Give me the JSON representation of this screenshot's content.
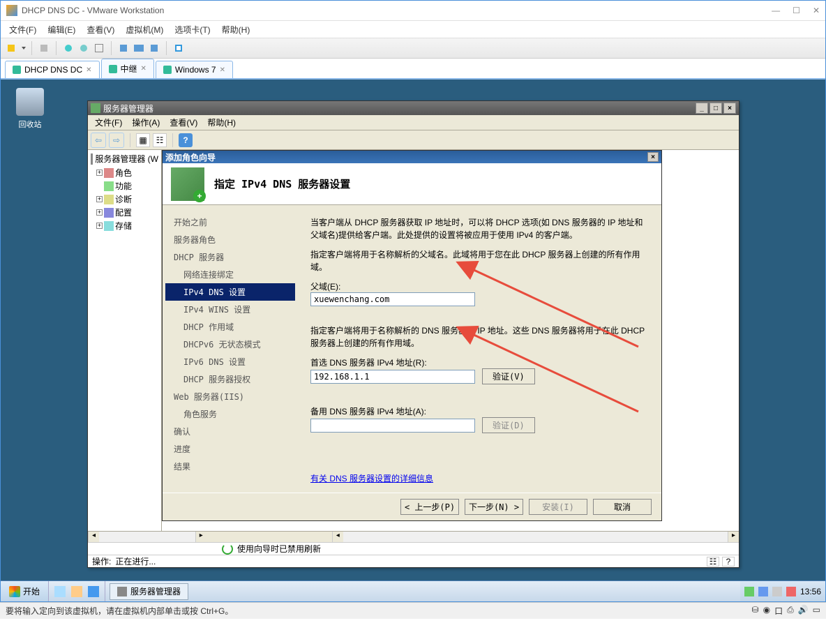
{
  "vmware": {
    "title": "DHCP DNS DC - VMware Workstation",
    "menu": [
      "文件(F)",
      "编辑(E)",
      "查看(V)",
      "虚拟机(M)",
      "选项卡(T)",
      "帮助(H)"
    ],
    "tabs": [
      {
        "label": "DHCP DNS DC",
        "active": true
      },
      {
        "label": "中继",
        "active": false
      },
      {
        "label": "Windows 7",
        "active": false
      }
    ],
    "status": "要将输入定向到该虚拟机，请在虚拟机内部单击或按 Ctrl+G。"
  },
  "desktop": {
    "recycle_bin": "回收站"
  },
  "srvmgr": {
    "title": "服务器管理器",
    "menu": [
      "文件(F)",
      "操作(A)",
      "查看(V)",
      "帮助(H)"
    ],
    "tree_root": "服务器管理器 (W",
    "tree_items": [
      "角色",
      "功能",
      "诊断",
      "配置",
      "存储"
    ],
    "refresh_msg": "使用向导时已禁用刷新",
    "op_label": "操作:",
    "op_status": "正在进行..."
  },
  "wizard": {
    "title": "添加角色向导",
    "heading": "指定 IPv4 DNS 服务器设置",
    "nav": [
      {
        "label": "开始之前",
        "level": 1
      },
      {
        "label": "服务器角色",
        "level": 1
      },
      {
        "label": "DHCP 服务器",
        "level": 1
      },
      {
        "label": "网络连接绑定",
        "level": 2
      },
      {
        "label": "IPv4 DNS 设置",
        "level": 2,
        "active": true
      },
      {
        "label": "IPv4 WINS 设置",
        "level": 2
      },
      {
        "label": "DHCP 作用域",
        "level": 2
      },
      {
        "label": "DHCPv6 无状态模式",
        "level": 2
      },
      {
        "label": "IPv6 DNS 设置",
        "level": 2
      },
      {
        "label": "DHCP 服务器授权",
        "level": 2
      },
      {
        "label": "Web 服务器(IIS)",
        "level": 1
      },
      {
        "label": "角色服务",
        "level": 2
      },
      {
        "label": "确认",
        "level": 1
      },
      {
        "label": "进度",
        "level": 1
      },
      {
        "label": "结果",
        "level": 1
      }
    ],
    "intro1": "当客户端从 DHCP 服务器获取 IP 地址时，可以将 DHCP 选项(如 DNS 服务器的 IP 地址和父域名)提供给客户端。此处提供的设置将被应用于使用 IPv4 的客户端。",
    "intro2": "指定客户端将用于名称解析的父域名。此域将用于您在此 DHCP 服务器上创建的所有作用域。",
    "parent_domain_label": "父域(E):",
    "parent_domain_value": "xuewenchang.com",
    "dns_intro": "指定客户端将用于名称解析的 DNS 服务器的 IP 地址。这些 DNS 服务器将用于在此 DHCP 服务器上创建的所有作用域。",
    "pref_dns_label": "首选 DNS 服务器 IPv4 地址(R):",
    "pref_dns_value": "192.168.1.1",
    "alt_dns_label": "备用 DNS 服务器 IPv4 地址(A):",
    "alt_dns_value": "",
    "validate_btn": "验证(V)",
    "validate_btn2": "验证(D)",
    "more_link": "有关 DNS 服务器设置的详细信息",
    "btn_prev": "< 上一步(P)",
    "btn_next": "下一步(N) >",
    "btn_install": "安装(I)",
    "btn_cancel": "取消"
  },
  "taskbar": {
    "start": "开始",
    "task1": "服务器管理器",
    "clock": "13:56"
  }
}
